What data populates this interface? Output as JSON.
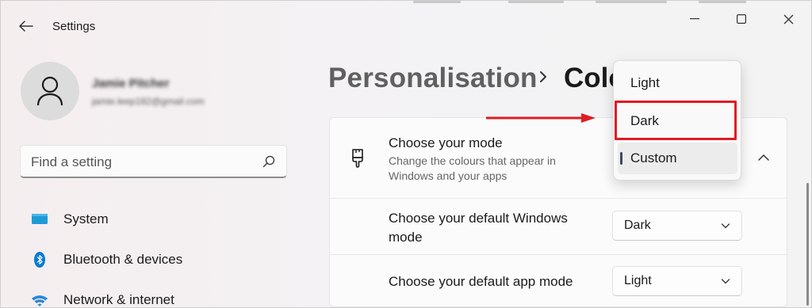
{
  "window": {
    "title": "Settings"
  },
  "account": {
    "name": "Jamie Pitcher",
    "email": "jamie.leep182@gmail.com"
  },
  "search": {
    "placeholder": "Find a setting"
  },
  "sidebar": {
    "items": [
      {
        "label": "System",
        "icon": "monitor-icon"
      },
      {
        "label": "Bluetooth & devices",
        "icon": "bluetooth-icon"
      },
      {
        "label": "Network & internet",
        "icon": "wifi-icon"
      }
    ]
  },
  "breadcrumb": {
    "parent": "Personalisation",
    "current": "Colours"
  },
  "mode_card": {
    "title": "Choose your mode",
    "subtitle": "Change the colours that appear in Windows and your apps",
    "icon": "brush-icon",
    "rows": [
      {
        "label": "Choose your default Windows mode",
        "value": "Dark"
      },
      {
        "label": "Choose your default app mode",
        "value": "Light"
      }
    ]
  },
  "mode_dropdown": {
    "options": [
      "Light",
      "Dark",
      "Custom"
    ],
    "selected": "Custom",
    "highlighted": "Dark"
  },
  "colors": {
    "accent": "#3c4a62",
    "highlight": "#e01b24",
    "system_icon": "#1e9bd7",
    "bluetooth_icon": "#0a7ad1"
  }
}
